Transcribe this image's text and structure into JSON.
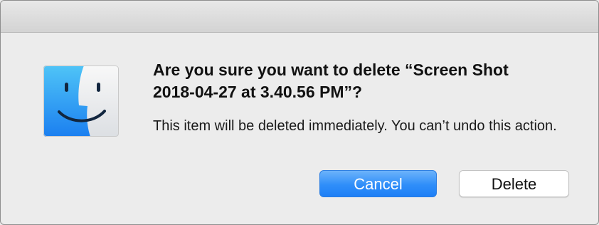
{
  "dialog": {
    "message": "Are you sure you want to delete “Screen Shot 2018-04-27 at 3.40.56 PM”?",
    "informative_text": "This item will be deleted immediately. You can’t undo this action.",
    "app_icon": "finder-icon"
  },
  "buttons": {
    "cancel_label": "Cancel",
    "delete_label": "Delete"
  },
  "colors": {
    "accent": "#2f8ef9",
    "background": "#ececec"
  }
}
